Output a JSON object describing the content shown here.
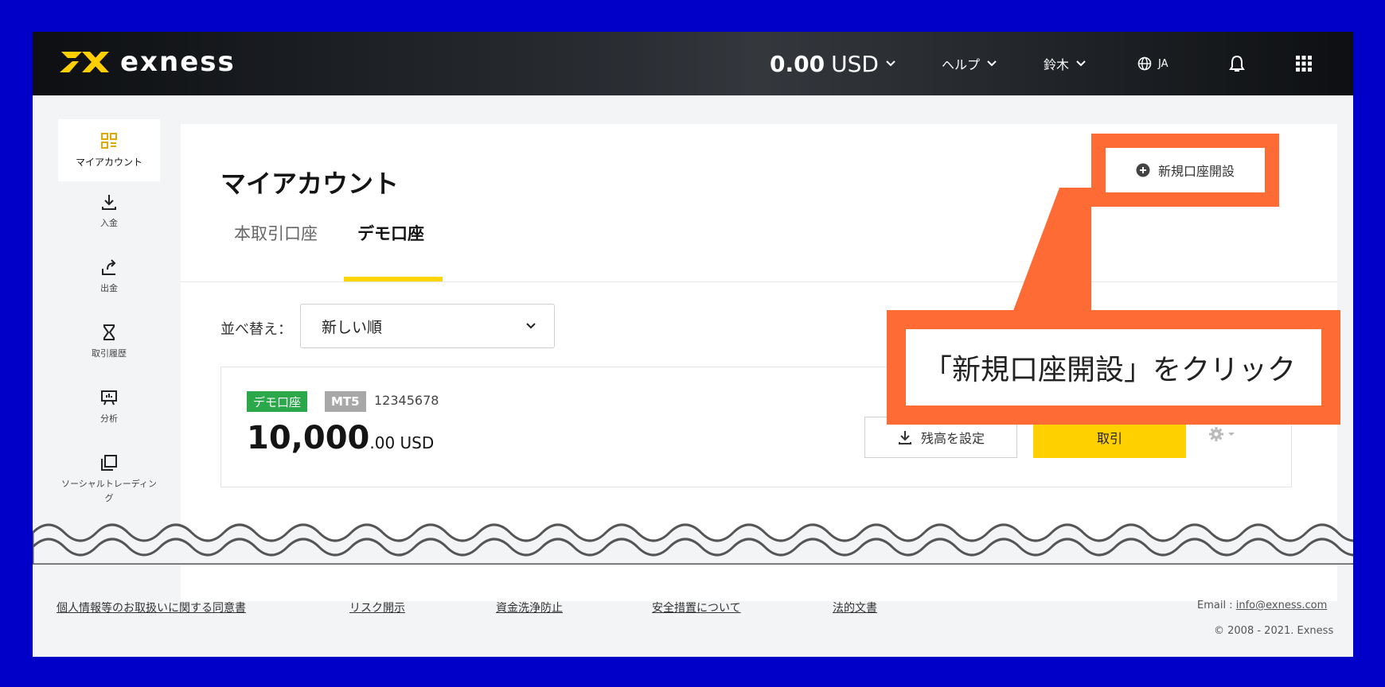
{
  "header": {
    "brand": "exness",
    "balance_amount": "0.00",
    "balance_currency": "USD",
    "help": "ヘルプ",
    "user": "鈴木",
    "language": "JA"
  },
  "sidebar": {
    "items": [
      {
        "label": "マイアカウント",
        "icon": "grid-apps-icon"
      },
      {
        "label": "入金",
        "icon": "download-icon"
      },
      {
        "label": "出金",
        "icon": "upload-icon"
      },
      {
        "label": "取引履歴",
        "icon": "hourglass-icon"
      },
      {
        "label": "分析",
        "icon": "presentation-icon"
      },
      {
        "label": "ソーシャルトレーディング",
        "icon": "copy-icon"
      },
      {
        "label": "",
        "icon": "chart-icon"
      }
    ]
  },
  "main": {
    "title": "マイアカウント",
    "tabs": [
      {
        "label": "本取引口座",
        "active": false
      },
      {
        "label": "デモ口座",
        "active": true
      }
    ],
    "new_account_button": "新規口座開設",
    "sort_label": "並べ替え：",
    "sort_value": "新しい順"
  },
  "account": {
    "type_badge": "デモ口座",
    "platform_badge": "MT5",
    "number": "12345678",
    "amount_main": "10,000",
    "amount_decimal": ".00 USD",
    "set_balance_button": "残高を設定",
    "trade_button": "取引"
  },
  "callout": {
    "text": "「新規口座開設」をクリック"
  },
  "footer": {
    "links": [
      "個人情報等のお取扱いに関する同意書",
      "リスク開示",
      "資金洗浄防止",
      "安全措置について",
      "法的文書"
    ],
    "email_label": "Email :",
    "email": "info@exness.com",
    "copyright": "© 2008 - 2021. Exness"
  },
  "colors": {
    "accent_yellow": "#ffd000",
    "callout_orange": "#ff6b35",
    "demo_green": "#2aa84a",
    "frame_blue": "#0000c8"
  }
}
